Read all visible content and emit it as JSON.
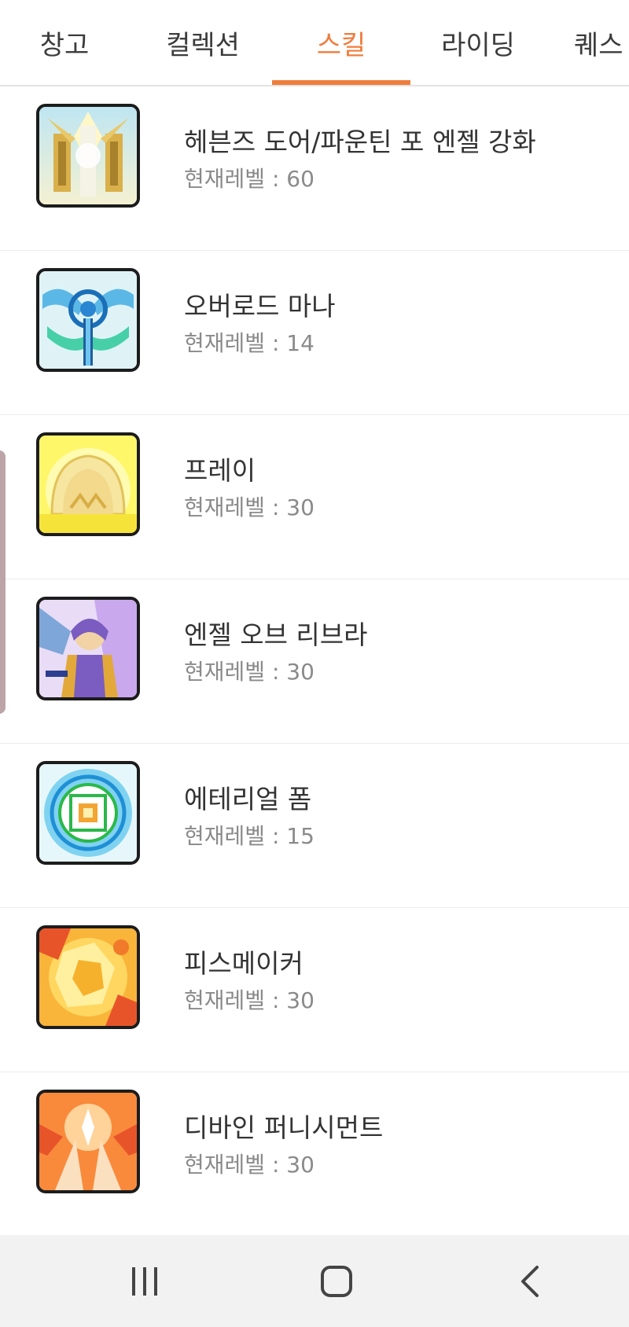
{
  "tabs": [
    {
      "label": "창고",
      "active": false
    },
    {
      "label": "컬렉션",
      "active": false
    },
    {
      "label": "스킬",
      "active": true
    },
    {
      "label": "라이딩",
      "active": false
    },
    {
      "label": "퀘스",
      "active": false
    }
  ],
  "accent_color": "#ef7d3c",
  "skills": [
    {
      "name": "헤븐즈 도어/파운틴 포 엔젤 강화",
      "level": "현재레벨 : 60",
      "icon": "heavens-door-icon"
    },
    {
      "name": "오버로드 마나",
      "level": "현재레벨 : 14",
      "icon": "overload-mana-icon"
    },
    {
      "name": "프레이",
      "level": "현재레벨 : 30",
      "icon": "pray-icon"
    },
    {
      "name": "엔젤 오브 리브라",
      "level": "현재레벨 : 30",
      "icon": "angel-of-libra-icon"
    },
    {
      "name": "에테리얼 폼",
      "level": "현재레벨 : 15",
      "icon": "ethereal-form-icon"
    },
    {
      "name": "피스메이커",
      "level": "현재레벨 : 30",
      "icon": "peacemaker-icon"
    },
    {
      "name": "디바인 퍼니시먼트",
      "level": "현재레벨 : 30",
      "icon": "divine-punishment-icon"
    }
  ],
  "navbar": {
    "recent_icon": "recent-apps-icon",
    "home_icon": "home-icon",
    "back_icon": "back-icon"
  }
}
